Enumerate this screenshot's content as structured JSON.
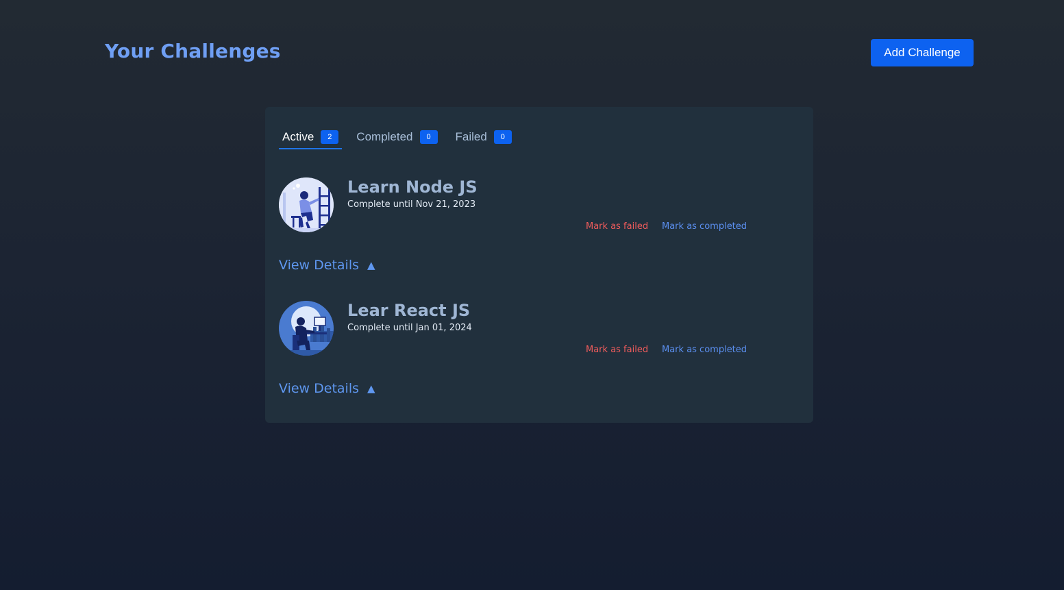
{
  "header": {
    "title": "Your Challenges",
    "add_button_label": "Add Challenge"
  },
  "tabs": [
    {
      "label": "Active",
      "count": "2",
      "active": true
    },
    {
      "label": "Completed",
      "count": "0",
      "active": false
    },
    {
      "label": "Failed",
      "count": "0",
      "active": false
    }
  ],
  "challenges": [
    {
      "title": "Learn Node JS",
      "deadline": "Complete until Nov 21, 2023",
      "fail_label": "Mark as failed",
      "complete_label": "Mark as completed",
      "details_label": "View Details",
      "details_icon": "▲",
      "image": "person-climbing-ladder-illustration"
    },
    {
      "title": "Lear React JS",
      "deadline": "Complete until Jan 01, 2024",
      "fail_label": "Mark as failed",
      "complete_label": "Mark as completed",
      "details_label": "View Details",
      "details_icon": "▲",
      "image": "person-at-computer-illustration"
    }
  ],
  "colors": {
    "accent": "#0d62f0",
    "title": "#6f9ff4",
    "failed": "#f05c5c",
    "completed": "#5b8ff0"
  }
}
